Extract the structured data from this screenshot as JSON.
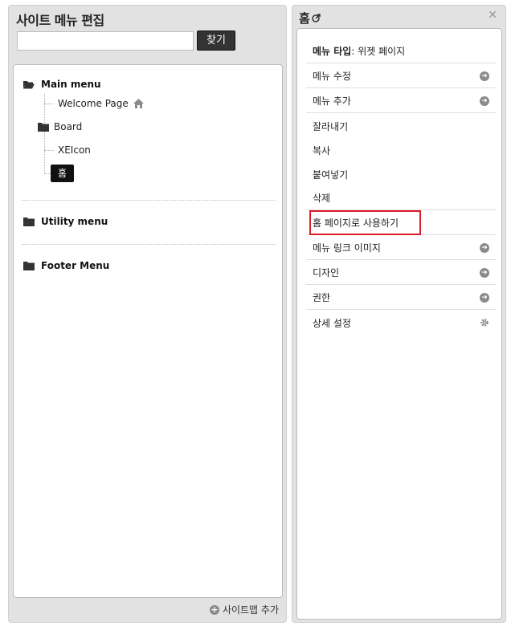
{
  "left_panel": {
    "title": "사이트 메뉴 편집",
    "search": {
      "placeholder": "",
      "value": "",
      "button_label": "찾기"
    },
    "groups": [
      {
        "label": "Main menu",
        "expanded": true,
        "children": [
          "Welcome Page",
          "Board",
          "XEIcon",
          "홈"
        ]
      },
      {
        "label": "Utility menu",
        "expanded": false,
        "children": []
      },
      {
        "label": "Footer Menu",
        "expanded": false,
        "children": []
      }
    ],
    "footer_label": "사이트맵 추가"
  },
  "right_panel": {
    "title": "홈",
    "menu_type_label": "메뉴 타입",
    "menu_type_value": ": 위젯 페이지",
    "actions": [
      {
        "label": "메뉴 수정",
        "icon": "arrow-right-circle-icon"
      },
      {
        "label": "메뉴 추가",
        "icon": "arrow-right-circle-icon"
      },
      {
        "label": "잘라내기",
        "icon": ""
      },
      {
        "label": "복사",
        "icon": ""
      },
      {
        "label": "붙여넣기",
        "icon": ""
      },
      {
        "label": "삭제",
        "icon": ""
      },
      {
        "label": "홈 페이지로 사용하기",
        "icon": "",
        "highlighted": true
      },
      {
        "label": "메뉴 링크 이미지",
        "icon": "arrow-right-circle-icon"
      },
      {
        "label": "디자인",
        "icon": "arrow-right-circle-icon"
      },
      {
        "label": "권한",
        "icon": "arrow-right-circle-icon"
      },
      {
        "label": "상세 설정",
        "icon": "gear-icon"
      }
    ]
  },
  "colors": {
    "highlight": "#d91e2a",
    "button_bg": "#333333",
    "selected_bg": "#111111"
  }
}
